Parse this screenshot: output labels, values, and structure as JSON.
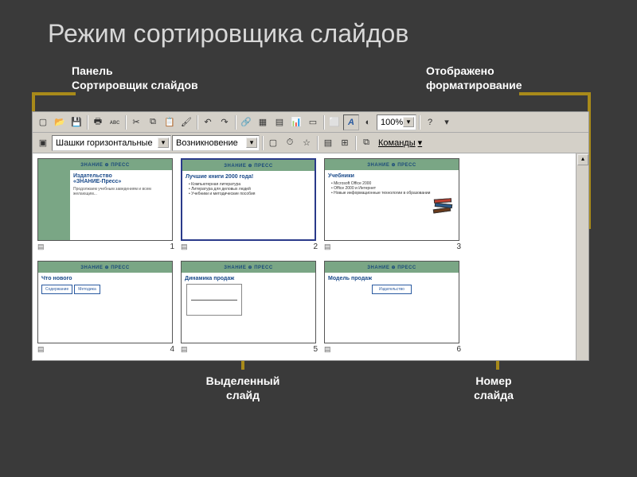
{
  "page_title": "Режим сортировщика слайдов",
  "labels": {
    "sorter_panel": "Панель\nСортировщик слайдов",
    "format_shown": "Отображено\nформатирование",
    "selected_slide": "Выделенный\nслайд",
    "slide_number": "Номер\nслайда"
  },
  "toolbar1": {
    "transition_effect": "Шашки горизонтальные",
    "transition_speed": "Возникновение",
    "commands_label": "Команды"
  },
  "zoom_value": "100%",
  "slides": [
    {
      "brand": "ЗНАНИЕ ⊕ ПРЕСС",
      "title": "Издательство\n«ЗНАНИЕ-Пресс»",
      "sub": "Продолжаем учебным заведениям и всем желающим...",
      "num": "1"
    },
    {
      "brand": "ЗНАНИЕ ⊕ ПРЕСС",
      "title": "Лучшие книги 2000 года!",
      "bullets": [
        "Компьютерная литература",
        "Литература для деловых людей",
        "Учебники и методические пособия"
      ],
      "num": "2",
      "selected": true
    },
    {
      "brand": "ЗНАНИЕ ⊕ ПРЕСС",
      "title": "Учебники",
      "bullets": [
        "Microsoft Office 2000",
        "Office 2000 и Интернет",
        "Новые информационные технологии в образовании"
      ],
      "num": "3",
      "books": true
    },
    {
      "brand": "ЗНАНИЕ ⊕ ПРЕСС",
      "title": "Что нового",
      "boxes": [
        "Содержание",
        "Методика"
      ],
      "num": "4"
    },
    {
      "brand": "ЗНАНИЕ ⊕ ПРЕСС",
      "title": "Динамика продаж",
      "chart": true,
      "num": "5"
    },
    {
      "brand": "ЗНАНИЕ ⊕ ПРЕСС",
      "title": "Модель продаж",
      "diagram": true,
      "num": "6"
    }
  ]
}
